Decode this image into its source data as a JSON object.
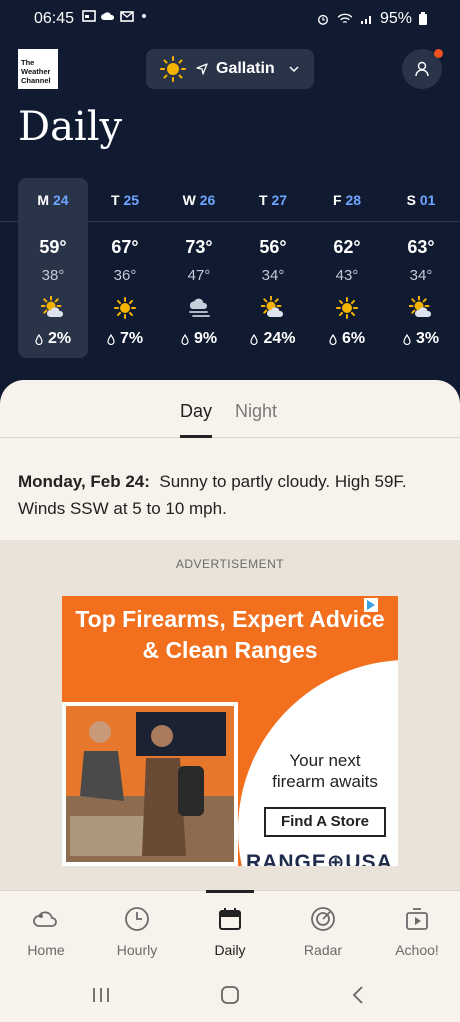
{
  "status": {
    "time": "06:45",
    "battery": "95%"
  },
  "header": {
    "logo_line1": "The",
    "logo_line2": "Weather",
    "logo_line3": "Channel",
    "location": "Gallatin",
    "title": "Daily"
  },
  "days": [
    {
      "letter": "M",
      "num": "24",
      "hi": "59°",
      "lo": "38°",
      "icon": "partly-cloudy-sun-icon",
      "precip": "2%",
      "selected": true
    },
    {
      "letter": "T",
      "num": "25",
      "hi": "67°",
      "lo": "36°",
      "icon": "sunny-icon",
      "precip": "7%"
    },
    {
      "letter": "W",
      "num": "26",
      "hi": "73°",
      "lo": "47°",
      "icon": "cloudy-windy-icon",
      "precip": "9%"
    },
    {
      "letter": "T",
      "num": "27",
      "hi": "56°",
      "lo": "34°",
      "icon": "partly-cloudy-sun-icon",
      "precip": "24%"
    },
    {
      "letter": "F",
      "num": "28",
      "hi": "62°",
      "lo": "43°",
      "icon": "sunny-icon",
      "precip": "6%"
    },
    {
      "letter": "S",
      "num": "01",
      "hi": "63°",
      "lo": "34°",
      "icon": "partly-cloudy-sun-icon",
      "precip": "3%"
    }
  ],
  "tabs": {
    "day": "Day",
    "night": "Night"
  },
  "summary": {
    "date": "Monday, Feb 24:",
    "text": "Sunny to partly cloudy. High 59F. Winds SSW at 5 to 10 mph."
  },
  "ad": {
    "label": "ADVERTISEMENT",
    "headline1": "Top Firearms, Expert Advice",
    "headline2": "& Clean Ranges",
    "tagline1": "Your next",
    "tagline2": "firearm awaits",
    "cta": "Find A Store",
    "brand": "RANGE⊕USA"
  },
  "nav": [
    {
      "label": "Home",
      "icon": "home-cloud-icon"
    },
    {
      "label": "Hourly",
      "icon": "clock-icon"
    },
    {
      "label": "Daily",
      "icon": "calendar-icon",
      "active": true
    },
    {
      "label": "Radar",
      "icon": "radar-icon"
    },
    {
      "label": "Achoo!",
      "icon": "achoo-icon"
    }
  ],
  "colors": {
    "bg_dark": "#101a30",
    "accent_blue": "#6fa6ff",
    "notification": "#f0521e",
    "sun": "#f5b301",
    "ad_orange": "#f26f1e"
  }
}
